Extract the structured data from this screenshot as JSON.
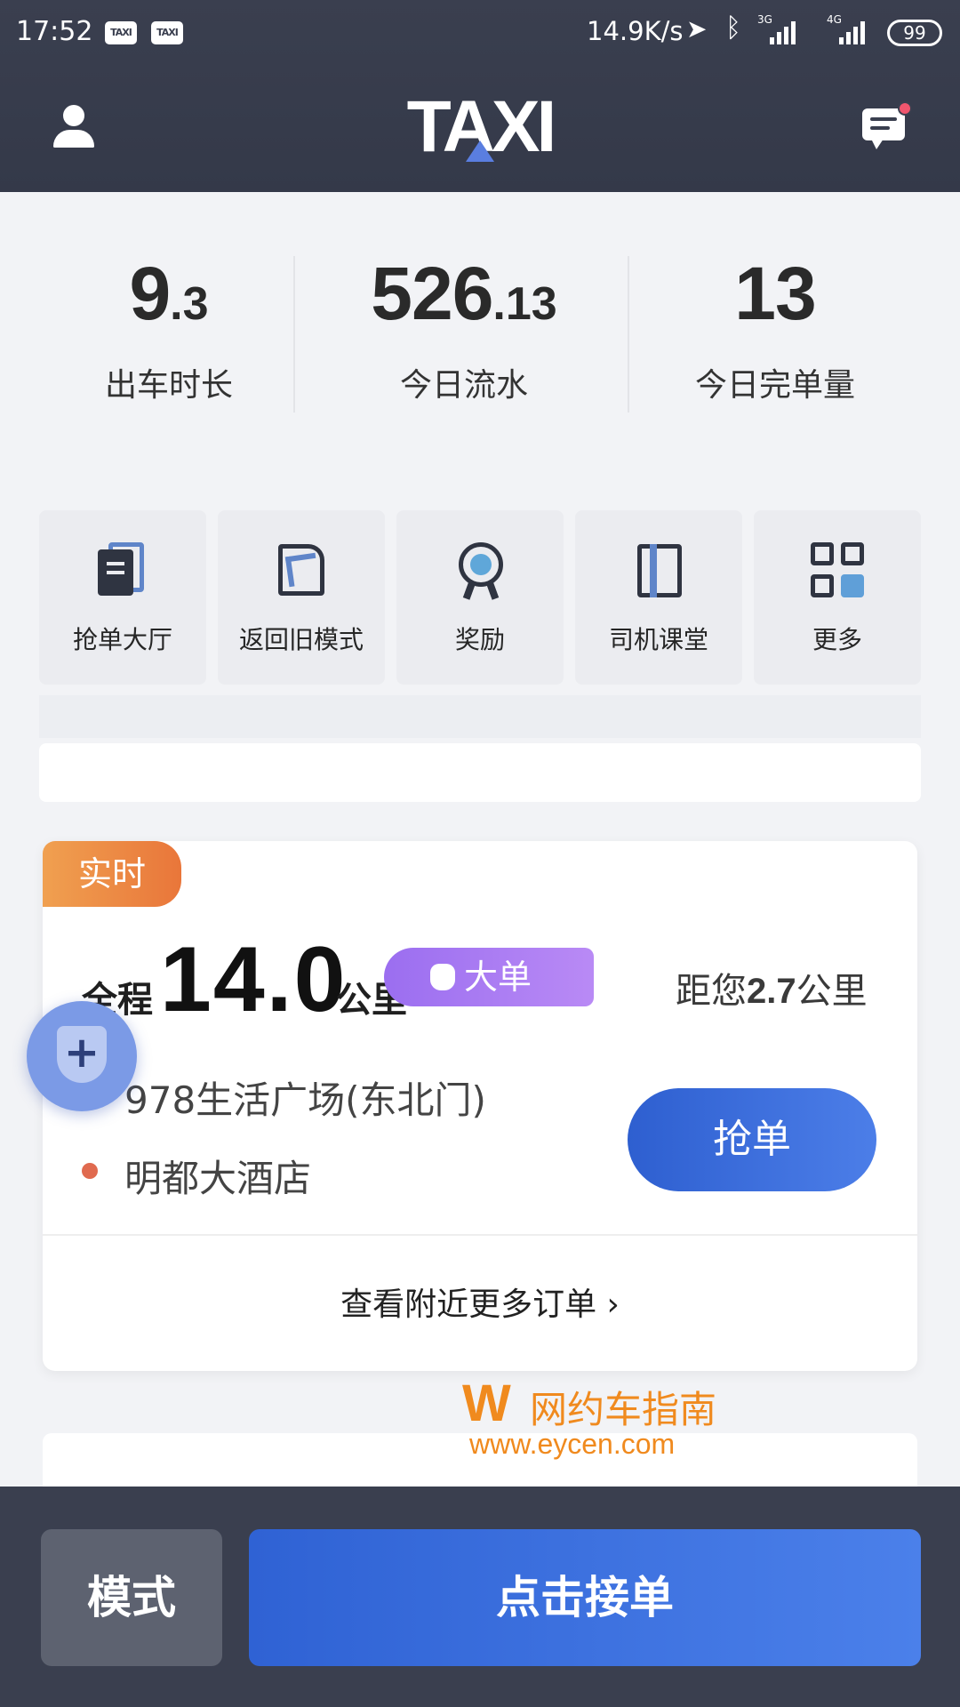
{
  "status_bar": {
    "time": "17:52",
    "app_icon_1": "TAXI",
    "app_icon_2": "TAXI",
    "net_speed": "14.9K/s",
    "net_3g": "3G",
    "net_4g": "4G",
    "battery": "99"
  },
  "header": {
    "logo": "TAXI"
  },
  "stats": [
    {
      "value_int": "9",
      "value_dec": ".3",
      "label": "出车时长"
    },
    {
      "value_int": "526",
      "value_dec": ".13",
      "label": "今日流水"
    },
    {
      "value_int": "13",
      "value_dec": "",
      "label": "今日完单量"
    }
  ],
  "quick_menu": [
    {
      "label": "抢单大厅",
      "icon": "order-hall-icon"
    },
    {
      "label": "返回旧模式",
      "icon": "return-icon"
    },
    {
      "label": "奖励",
      "icon": "reward-medal-icon"
    },
    {
      "label": "司机课堂",
      "icon": "book-icon"
    },
    {
      "label": "更多",
      "icon": "grid-more-icon"
    }
  ],
  "order": {
    "tag": "实时",
    "trip_prefix": "全程",
    "trip_distance": "14.0",
    "trip_unit": "公里",
    "badge": "大单",
    "distance_to_you_prefix": "距您",
    "distance_to_you": "2.7",
    "distance_to_you_unit": "公里",
    "pickup": "978生活广场(东北门)",
    "dropoff": "明都大酒店",
    "grab_button": "抢单",
    "more_orders": "查看附近更多订单",
    "colors": {
      "tag": "#e9763a",
      "badge": "#9b6ef0",
      "dropoff_dot": "#e06a4f",
      "pickup_dot": "#9aa0ab"
    }
  },
  "watermark": {
    "logo": "W",
    "title": "网约车指南",
    "url": "www.eycen.com"
  },
  "bottom_bar": {
    "mode_button": "模式",
    "accept_button": "点击接单"
  },
  "theme": {
    "header_bg": "#3a3f4f",
    "accent_blue": "#2f62d4",
    "page_bg": "#f2f3f6"
  }
}
